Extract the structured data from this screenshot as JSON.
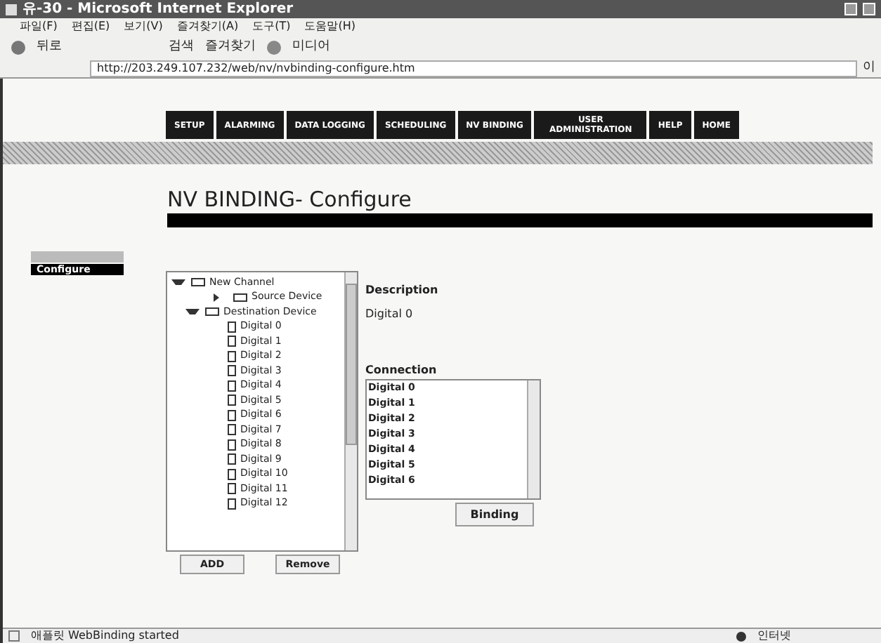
{
  "window": {
    "title": "유-30 - Microsoft Internet Explorer"
  },
  "menu": [
    "파일(F)",
    "편집(E)",
    "보기(V)",
    "즐겨찾기(A)",
    "도구(T)",
    "도움말(H)"
  ],
  "toolbar": {
    "back": "뒤로",
    "search": "검색",
    "favorites": "즐겨찾기",
    "media": "미디어"
  },
  "address": {
    "value": "http://203.249.107.232/web/nv/nvbinding-configure.htm",
    "go": "이"
  },
  "nav": [
    "SETUP",
    "ALARMING",
    "DATA LOGGING",
    "SCHEDULING",
    "NV BINDING",
    "USER ADMINISTRATION",
    "HELP",
    "HOME"
  ],
  "heading": "NV BINDING- Configure",
  "sidebar": [
    {
      "selected": false
    },
    {
      "label": "Configure",
      "selected": true
    }
  ],
  "tree": [
    {
      "label": "New Channel",
      "expanded": true,
      "children": [
        {
          "label": "Source Device",
          "expanded": false
        },
        {
          "label": "Destination Device",
          "expanded": true,
          "children": [
            {
              "label": "Digital 0"
            },
            {
              "label": "Digital 1"
            },
            {
              "label": "Digital 2"
            },
            {
              "label": "Digital 3"
            },
            {
              "label": "Digital 4"
            },
            {
              "label": "Digital 5"
            },
            {
              "label": "Digital 6"
            },
            {
              "label": "Digital 7"
            },
            {
              "label": "Digital 8"
            },
            {
              "label": "Digital 9"
            },
            {
              "label": "Digital 10"
            },
            {
              "label": "Digital 11"
            },
            {
              "label": "Digital 12"
            }
          ]
        }
      ]
    }
  ],
  "tree_buttons": [
    "ADD",
    "Remove"
  ],
  "description": {
    "label": "Description",
    "value": "Digital 0"
  },
  "connection": {
    "label": "Connection",
    "items": [
      "Digital 0",
      "Digital 1",
      "Digital 2",
      "Digital 3",
      "Digital 4",
      "Digital 5",
      "Digital 6"
    ]
  },
  "binding_button": "Binding",
  "status_bar": {
    "text": "애플릿 WebBinding started",
    "zone": "인터넷"
  }
}
